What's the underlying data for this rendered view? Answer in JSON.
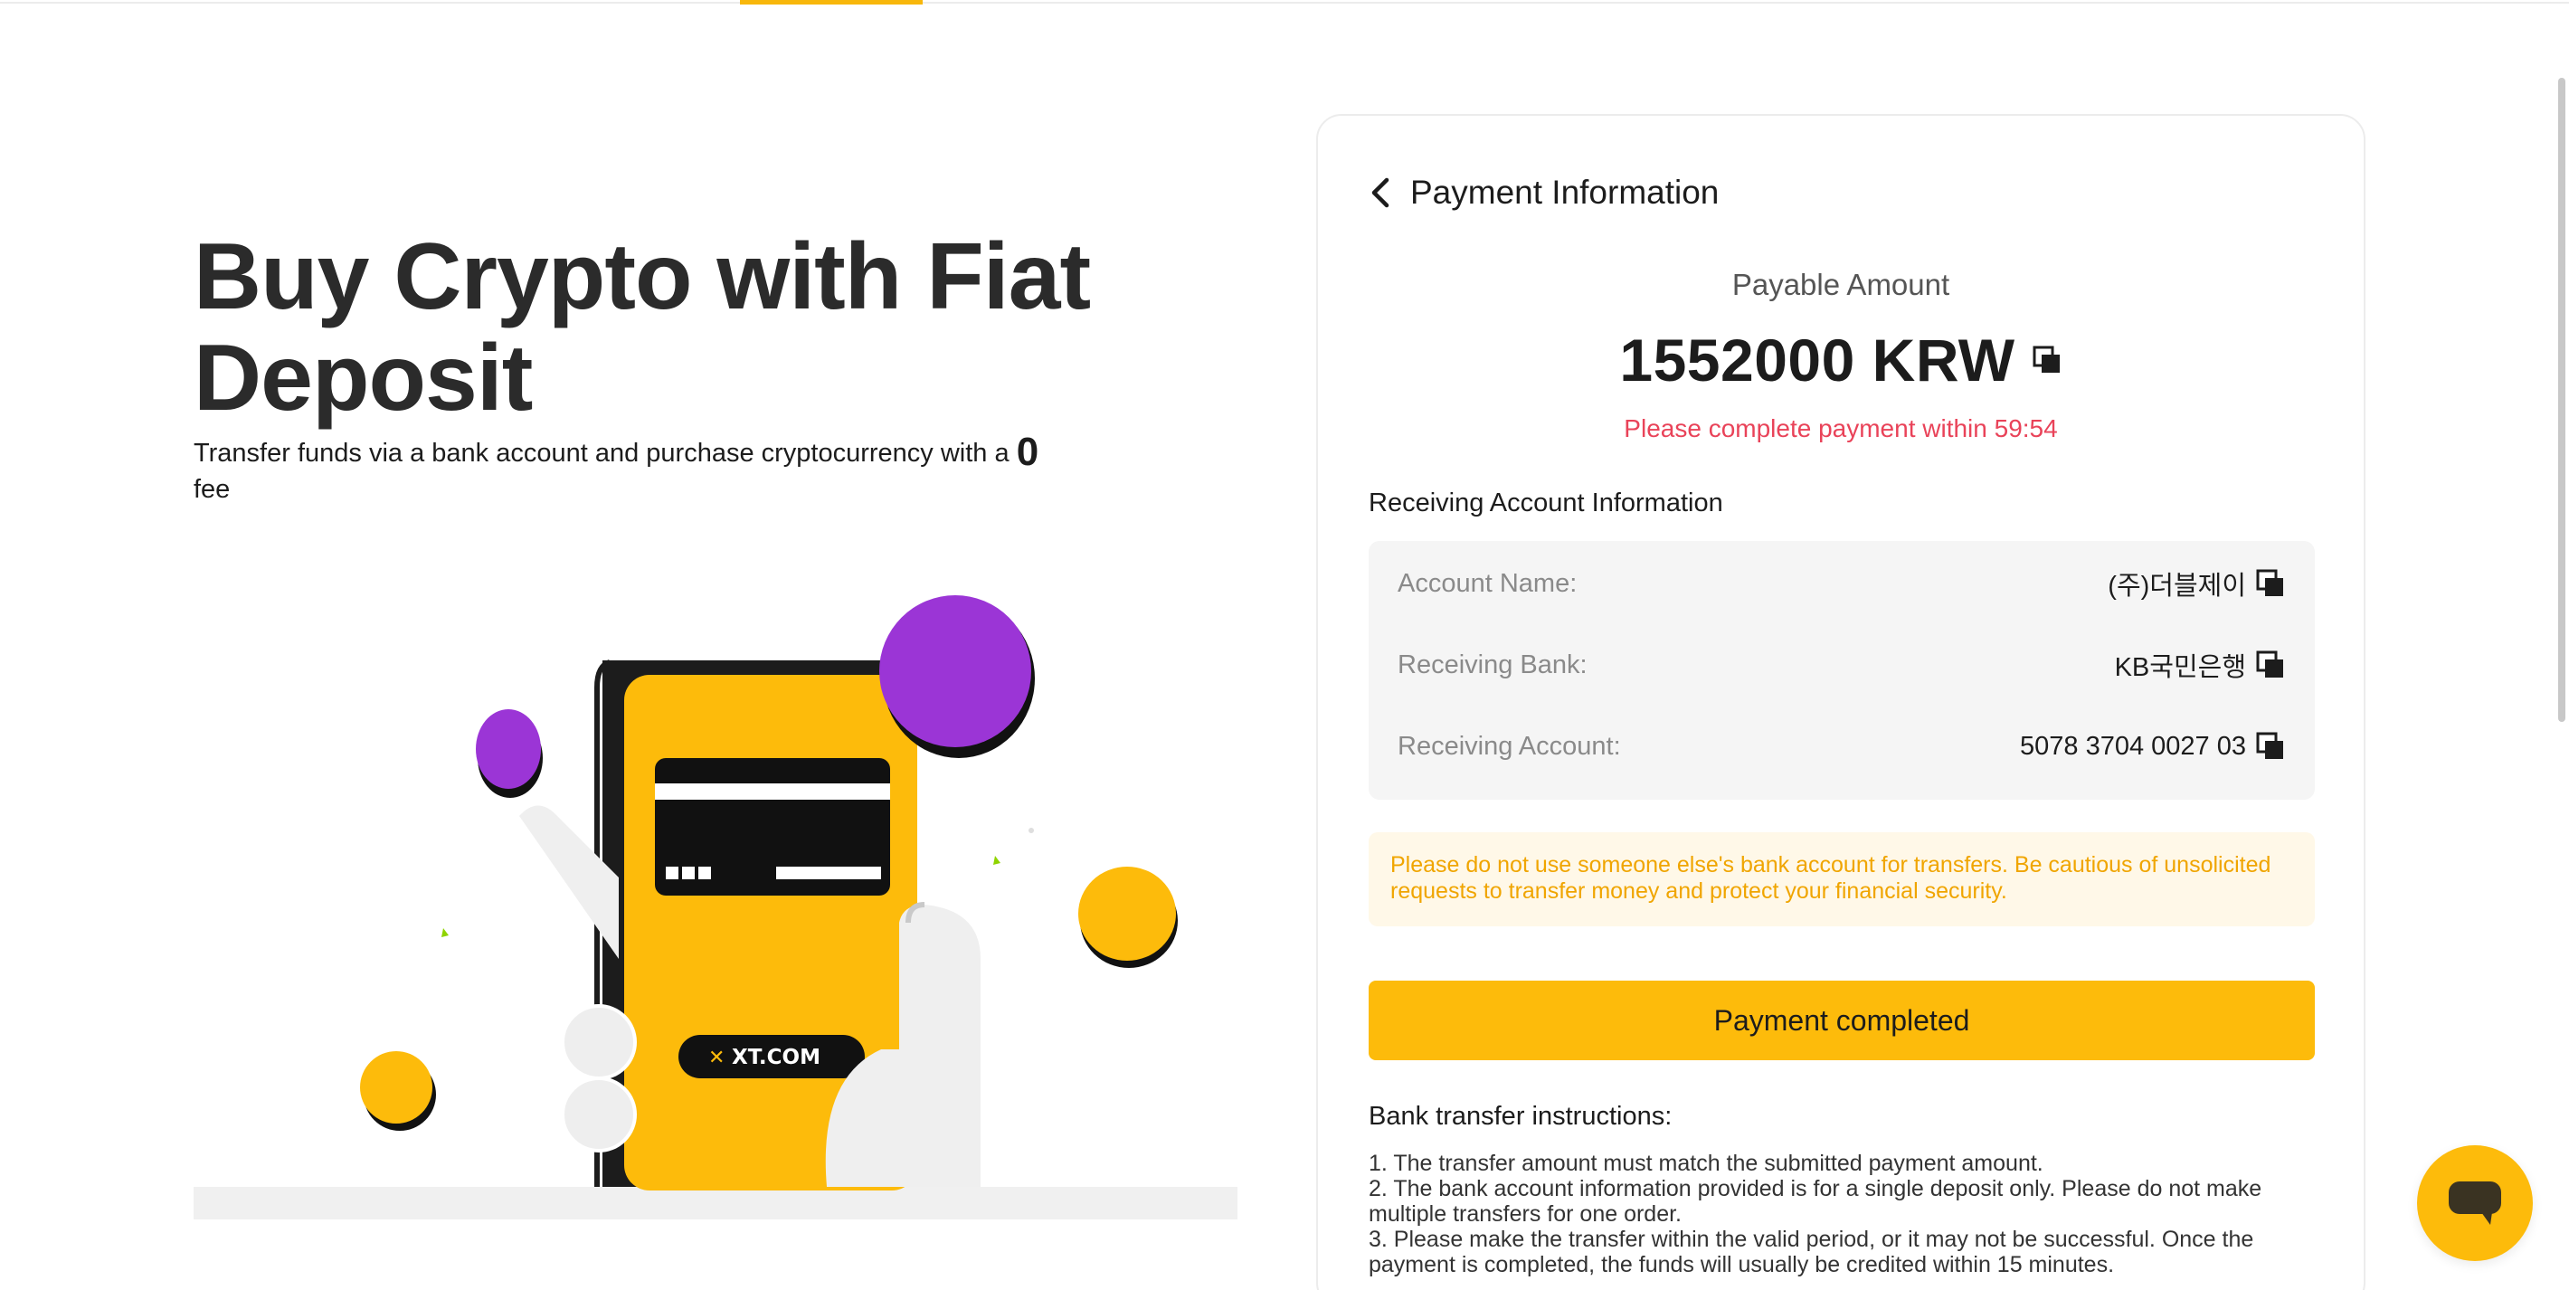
{
  "hero": {
    "title": "Buy Crypto with Fiat Deposit",
    "subtitle_prefix": "Transfer funds via a bank account and purchase cryptocurrency with a",
    "subtitle_zero": "0",
    "subtitle_suffix": "fee",
    "brand_logo_text": "XT.COM"
  },
  "card": {
    "title": "Payment Information",
    "payable_label": "Payable Amount",
    "amount": "1552000 KRW",
    "countdown": "Please complete payment within 59:54",
    "receiving_label": "Receiving Account Information",
    "account": [
      {
        "key": "Account Name:",
        "value": "(주)더블제이"
      },
      {
        "key": "Receiving Bank:",
        "value": "KB국민은행"
      },
      {
        "key": "Receiving Account:",
        "value": "5078 3704 0027 03"
      }
    ],
    "warning": "Please do not use someone else's bank account for transfers. Be cautious of unsolicited requests to transfer money and protect your financial security.",
    "pay_button": "Payment completed",
    "instructions_title": "Bank transfer instructions:",
    "instructions": [
      "1. The transfer amount must match the submitted payment amount.",
      "2. The bank account information provided is for a single deposit only. Please do not make multiple transfers for one order.",
      "3. Please make the transfer within the valid period, or it may not be successful. Once the payment is completed, the funds will usually be credited within 15 minutes."
    ]
  },
  "icons": {
    "back": "chevron-left-icon",
    "copy": "copy-icon",
    "chat": "chat-bubble-icon"
  },
  "colors": {
    "accent": "#fdbb0b",
    "countdown": "#e94359",
    "warning_text": "#f0a500",
    "warning_bg": "#fff8e8",
    "purple": "#9b35d6"
  }
}
